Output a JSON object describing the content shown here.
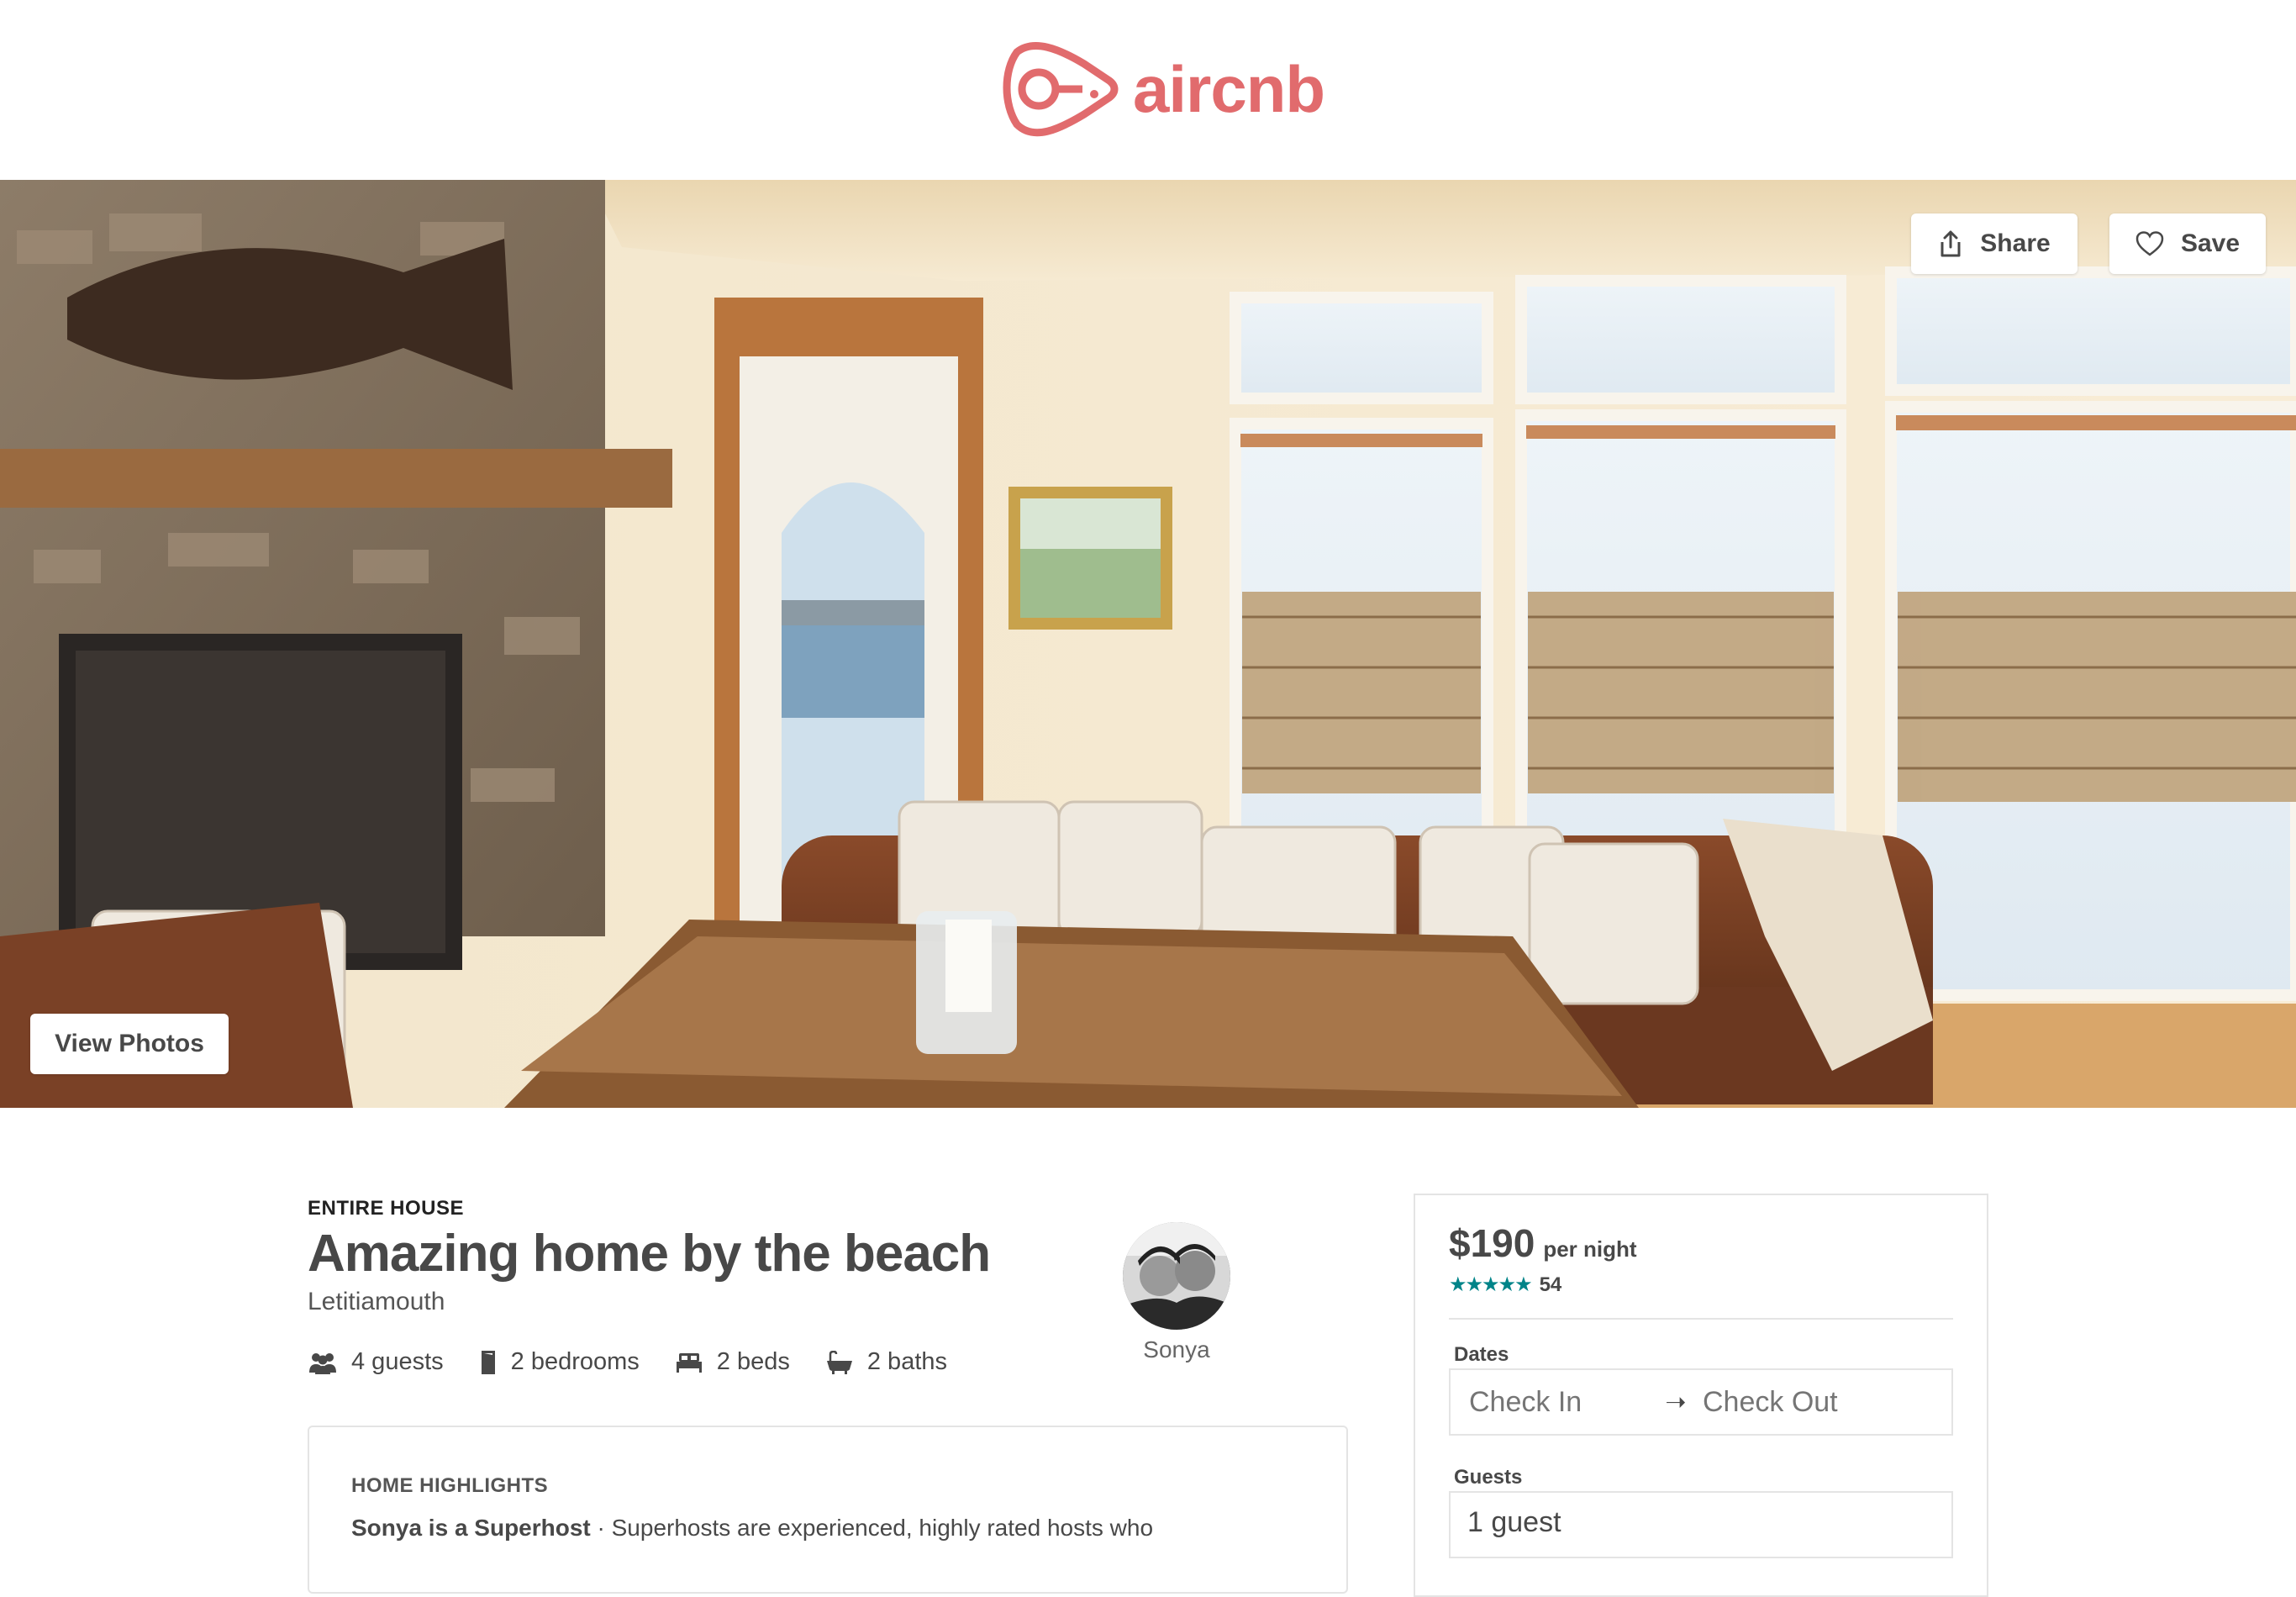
{
  "brand": {
    "name": "aircnb",
    "color": "#e16b6d"
  },
  "hero": {
    "share_label": "Share",
    "save_label": "Save",
    "view_photos_label": "View Photos"
  },
  "listing": {
    "type": "ENTIRE HOUSE",
    "title": "Amazing home by the beach",
    "location": "Letitiamouth",
    "amenities": [
      {
        "icon": "guests-icon",
        "label": "4 guests"
      },
      {
        "icon": "door-icon",
        "label": "2 bedrooms"
      },
      {
        "icon": "bed-icon",
        "label": "2 beds"
      },
      {
        "icon": "bathtub-icon",
        "label": "2 baths"
      }
    ]
  },
  "host": {
    "name": "Sonya"
  },
  "highlights": {
    "title": "HOME HIGHLIGHTS",
    "host_bold": "Sonya is a Superhost",
    "text": " · Superhosts are experienced, highly rated hosts who"
  },
  "booking": {
    "price": "$190",
    "per_night": "per night",
    "stars": "★★★★★",
    "star_color": "#008489",
    "review_count": "54",
    "dates_label": "Dates",
    "check_in_placeholder": "Check In",
    "check_out_placeholder": "Check Out",
    "arrow": "➝",
    "guests_label": "Guests",
    "guests_value": "1 guest"
  }
}
